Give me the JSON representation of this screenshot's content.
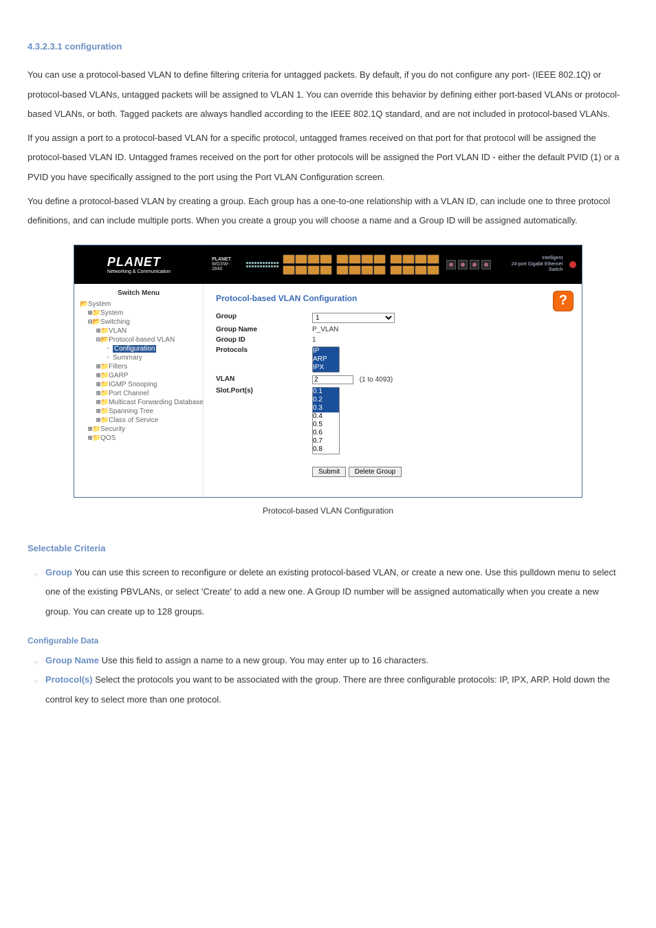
{
  "section_title": "4.3.2.3.1 configuration",
  "p1": "You can use a protocol-based VLAN to define filtering criteria for untagged packets. By default, if you do not configure any port- (IEEE 802.1Q) or protocol-based VLANs, untagged packets will be assigned to VLAN 1. You can override this behavior by defining either port-based VLANs or protocol-based VLANs, or both. Tagged packets are always handled according to the IEEE 802.1Q standard, and are not included in protocol-based VLANs.",
  "p2": "If you assign a port to a protocol-based VLAN for a specific protocol, untagged frames received on that port for that protocol will be assigned the protocol-based VLAN ID. Untagged frames received on the port for other protocols will be assigned the Port VLAN ID - either the default PVID (1) or a PVID you have specifically assigned to the port using the Port VLAN Configuration screen.",
  "p3": "You define a protocol-based VLAN by creating a group. Each group has a one-to-one relationship with a VLAN ID, can include one to three protocol definitions, and can include multiple ports. When you create a group you will choose a name and a Group ID will be assigned automatically.",
  "figure": {
    "help_label": "Help",
    "logo_main": "PLANET",
    "logo_sub": "Networking & Communication",
    "model_brand": "PLANET",
    "model_sub": "WGSW-2840",
    "right_txt1": "Intelligent",
    "right_txt2": "24-port Gigabit Ethernet Switch",
    "nav_title": "Switch Menu",
    "nav": {
      "system_root": "System",
      "system": "System",
      "switching": "Switching",
      "vlan": "VLAN",
      "pbv": "Protocol-based VLAN",
      "configuration": "Configuration",
      "summary": "Summary",
      "filters": "Filters",
      "garp": "GARP",
      "igmp": "IGMP Snooping",
      "portch": "Port Channel",
      "mcast": "Multicast Forwarding Database",
      "stp": "Spanning Tree",
      "cos": "Class of Service",
      "security": "Security",
      "qos": "QOS"
    },
    "main_title": "Protocol-based VLAN Configuration",
    "form": {
      "group_label": "Group",
      "group_value": "1",
      "group_name_label": "Group Name",
      "group_name_value": "P_VLAN",
      "group_id_label": "Group ID",
      "group_id_value": "1",
      "protocols_label": "Protocols",
      "protocols": [
        "IP",
        "ARP",
        "IPX"
      ],
      "vlan_label": "VLAN",
      "vlan_value": "2",
      "vlan_range": "(1 to 4093)",
      "slot_label": "Slot.Port(s)",
      "slots": [
        "0.1",
        "0.2",
        "0.3",
        "0.4",
        "0.5",
        "0.6",
        "0.7",
        "0.8"
      ],
      "submit_label": "Submit",
      "delete_label": "Delete Group"
    },
    "caption": "Protocol-based VLAN Configuration"
  },
  "selectable": {
    "title": "Selectable Criteria",
    "group": {
      "name": "Group",
      "desc": " You can use this screen to reconfigure or delete an existing protocol-based VLAN, or create a new one. Use this pulldown menu to select one of the existing PBVLANs, or select 'Create' to add a new one. A Group ID number will be assigned automatically when you create a new group. You can create up to 128 groups."
    }
  },
  "configurable": {
    "title": "Configurable Data",
    "group_name": {
      "name": "Group Name",
      "desc": " Use this field to assign a name to a new group. You may enter up to 16 characters."
    },
    "protocols": {
      "name": "Protocol(s)",
      "desc": " Select the protocols you want to be associated with the group. There are three configurable protocols: IP, IPX, ARP. Hold down the control key to select more than one protocol."
    }
  }
}
